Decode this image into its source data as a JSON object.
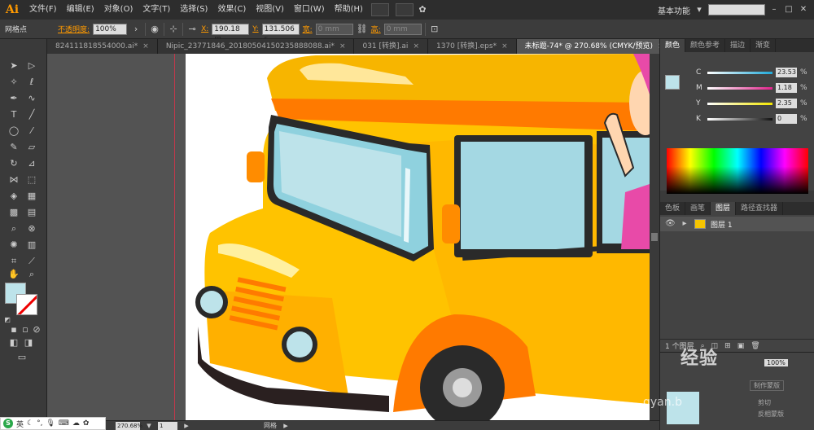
{
  "app": {
    "logo": "Ai"
  },
  "menu": [
    "文件(F)",
    "编辑(E)",
    "对象(O)",
    "文字(T)",
    "选择(S)",
    "效果(C)",
    "视图(V)",
    "窗口(W)",
    "帮助(H)"
  ],
  "workspace": {
    "label": "基本功能"
  },
  "control": {
    "selection_label": "网格点",
    "opacity_label": "不透明度:",
    "opacity_value": "100%",
    "x_label": "X:",
    "x_value": "190.18 m",
    "y_label": "Y:",
    "y_value": "131.506 r",
    "w_label": "宽:",
    "w_value": "0 mm",
    "h_label": "高:",
    "h_value": "0 mm"
  },
  "tabs": [
    {
      "label": "824111818554000.ai*",
      "active": false
    },
    {
      "label": "Nipic_23771846_20180504150235888088.ai*",
      "active": false
    },
    {
      "label": "031 [转换].ai",
      "active": false
    },
    {
      "label": "1370 [转换].eps*",
      "active": false
    },
    {
      "label": "未标题-74* @ 270.68% (CMYK/预览)",
      "active": true
    }
  ],
  "color_panel": {
    "tabs": [
      "颜色",
      "颜色参考",
      "描边",
      "渐变"
    ],
    "channels": [
      {
        "label": "C",
        "value": "23.53",
        "unit": "%",
        "color": "#1fa9d9"
      },
      {
        "label": "M",
        "value": "1.18",
        "unit": "%",
        "color": "#e0218a"
      },
      {
        "label": "Y",
        "value": "2.35",
        "unit": "%",
        "color": "#f2e600"
      },
      {
        "label": "K",
        "value": "0",
        "unit": "%",
        "color": "#111111"
      }
    ],
    "fill_color": "#bde3ea"
  },
  "layers_panel": {
    "tabs": [
      "色板",
      "画笔",
      "图层",
      "路径查找器"
    ],
    "layer_name": "图层 1",
    "count": "1 个图层"
  },
  "transparency_panel": {
    "opacity": "100%",
    "make_mask": "制作蒙版",
    "clip": "剪切",
    "invert": "反相蒙版"
  },
  "status": {
    "zoom": "270.68%",
    "page": "1",
    "tool_name": "网格"
  },
  "ime": {
    "lang": "英"
  },
  "watermark": {
    "main": "经验",
    "sub": "gyan.b"
  }
}
